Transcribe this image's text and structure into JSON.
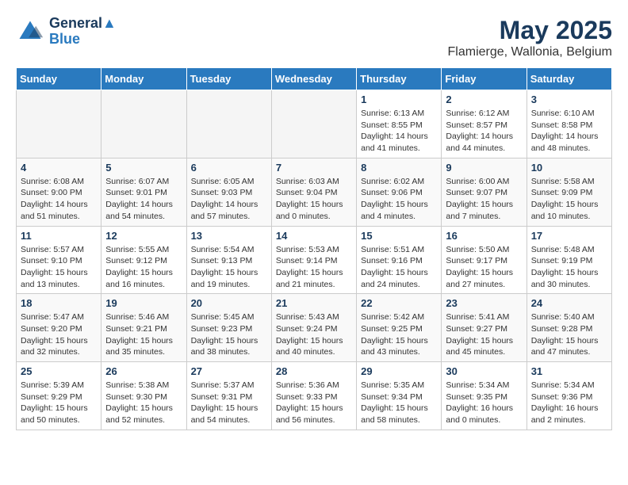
{
  "header": {
    "logo_line1": "General",
    "logo_line2": "Blue",
    "month_title": "May 2025",
    "location": "Flamierge, Wallonia, Belgium"
  },
  "days_of_week": [
    "Sunday",
    "Monday",
    "Tuesday",
    "Wednesday",
    "Thursday",
    "Friday",
    "Saturday"
  ],
  "weeks": [
    [
      {
        "num": "",
        "empty": true
      },
      {
        "num": "",
        "empty": true
      },
      {
        "num": "",
        "empty": true
      },
      {
        "num": "",
        "empty": true
      },
      {
        "num": "1",
        "sunrise": "6:13 AM",
        "sunset": "8:55 PM",
        "daylight": "14 hours and 41 minutes."
      },
      {
        "num": "2",
        "sunrise": "6:12 AM",
        "sunset": "8:57 PM",
        "daylight": "14 hours and 44 minutes."
      },
      {
        "num": "3",
        "sunrise": "6:10 AM",
        "sunset": "8:58 PM",
        "daylight": "14 hours and 48 minutes."
      }
    ],
    [
      {
        "num": "4",
        "sunrise": "6:08 AM",
        "sunset": "9:00 PM",
        "daylight": "14 hours and 51 minutes."
      },
      {
        "num": "5",
        "sunrise": "6:07 AM",
        "sunset": "9:01 PM",
        "daylight": "14 hours and 54 minutes."
      },
      {
        "num": "6",
        "sunrise": "6:05 AM",
        "sunset": "9:03 PM",
        "daylight": "14 hours and 57 minutes."
      },
      {
        "num": "7",
        "sunrise": "6:03 AM",
        "sunset": "9:04 PM",
        "daylight": "15 hours and 0 minutes."
      },
      {
        "num": "8",
        "sunrise": "6:02 AM",
        "sunset": "9:06 PM",
        "daylight": "15 hours and 4 minutes."
      },
      {
        "num": "9",
        "sunrise": "6:00 AM",
        "sunset": "9:07 PM",
        "daylight": "15 hours and 7 minutes."
      },
      {
        "num": "10",
        "sunrise": "5:58 AM",
        "sunset": "9:09 PM",
        "daylight": "15 hours and 10 minutes."
      }
    ],
    [
      {
        "num": "11",
        "sunrise": "5:57 AM",
        "sunset": "9:10 PM",
        "daylight": "15 hours and 13 minutes."
      },
      {
        "num": "12",
        "sunrise": "5:55 AM",
        "sunset": "9:12 PM",
        "daylight": "15 hours and 16 minutes."
      },
      {
        "num": "13",
        "sunrise": "5:54 AM",
        "sunset": "9:13 PM",
        "daylight": "15 hours and 19 minutes."
      },
      {
        "num": "14",
        "sunrise": "5:53 AM",
        "sunset": "9:14 PM",
        "daylight": "15 hours and 21 minutes."
      },
      {
        "num": "15",
        "sunrise": "5:51 AM",
        "sunset": "9:16 PM",
        "daylight": "15 hours and 24 minutes."
      },
      {
        "num": "16",
        "sunrise": "5:50 AM",
        "sunset": "9:17 PM",
        "daylight": "15 hours and 27 minutes."
      },
      {
        "num": "17",
        "sunrise": "5:48 AM",
        "sunset": "9:19 PM",
        "daylight": "15 hours and 30 minutes."
      }
    ],
    [
      {
        "num": "18",
        "sunrise": "5:47 AM",
        "sunset": "9:20 PM",
        "daylight": "15 hours and 32 minutes."
      },
      {
        "num": "19",
        "sunrise": "5:46 AM",
        "sunset": "9:21 PM",
        "daylight": "15 hours and 35 minutes."
      },
      {
        "num": "20",
        "sunrise": "5:45 AM",
        "sunset": "9:23 PM",
        "daylight": "15 hours and 38 minutes."
      },
      {
        "num": "21",
        "sunrise": "5:43 AM",
        "sunset": "9:24 PM",
        "daylight": "15 hours and 40 minutes."
      },
      {
        "num": "22",
        "sunrise": "5:42 AM",
        "sunset": "9:25 PM",
        "daylight": "15 hours and 43 minutes."
      },
      {
        "num": "23",
        "sunrise": "5:41 AM",
        "sunset": "9:27 PM",
        "daylight": "15 hours and 45 minutes."
      },
      {
        "num": "24",
        "sunrise": "5:40 AM",
        "sunset": "9:28 PM",
        "daylight": "15 hours and 47 minutes."
      }
    ],
    [
      {
        "num": "25",
        "sunrise": "5:39 AM",
        "sunset": "9:29 PM",
        "daylight": "15 hours and 50 minutes."
      },
      {
        "num": "26",
        "sunrise": "5:38 AM",
        "sunset": "9:30 PM",
        "daylight": "15 hours and 52 minutes."
      },
      {
        "num": "27",
        "sunrise": "5:37 AM",
        "sunset": "9:31 PM",
        "daylight": "15 hours and 54 minutes."
      },
      {
        "num": "28",
        "sunrise": "5:36 AM",
        "sunset": "9:33 PM",
        "daylight": "15 hours and 56 minutes."
      },
      {
        "num": "29",
        "sunrise": "5:35 AM",
        "sunset": "9:34 PM",
        "daylight": "15 hours and 58 minutes."
      },
      {
        "num": "30",
        "sunrise": "5:34 AM",
        "sunset": "9:35 PM",
        "daylight": "16 hours and 0 minutes."
      },
      {
        "num": "31",
        "sunrise": "5:34 AM",
        "sunset": "9:36 PM",
        "daylight": "16 hours and 2 minutes."
      }
    ]
  ]
}
